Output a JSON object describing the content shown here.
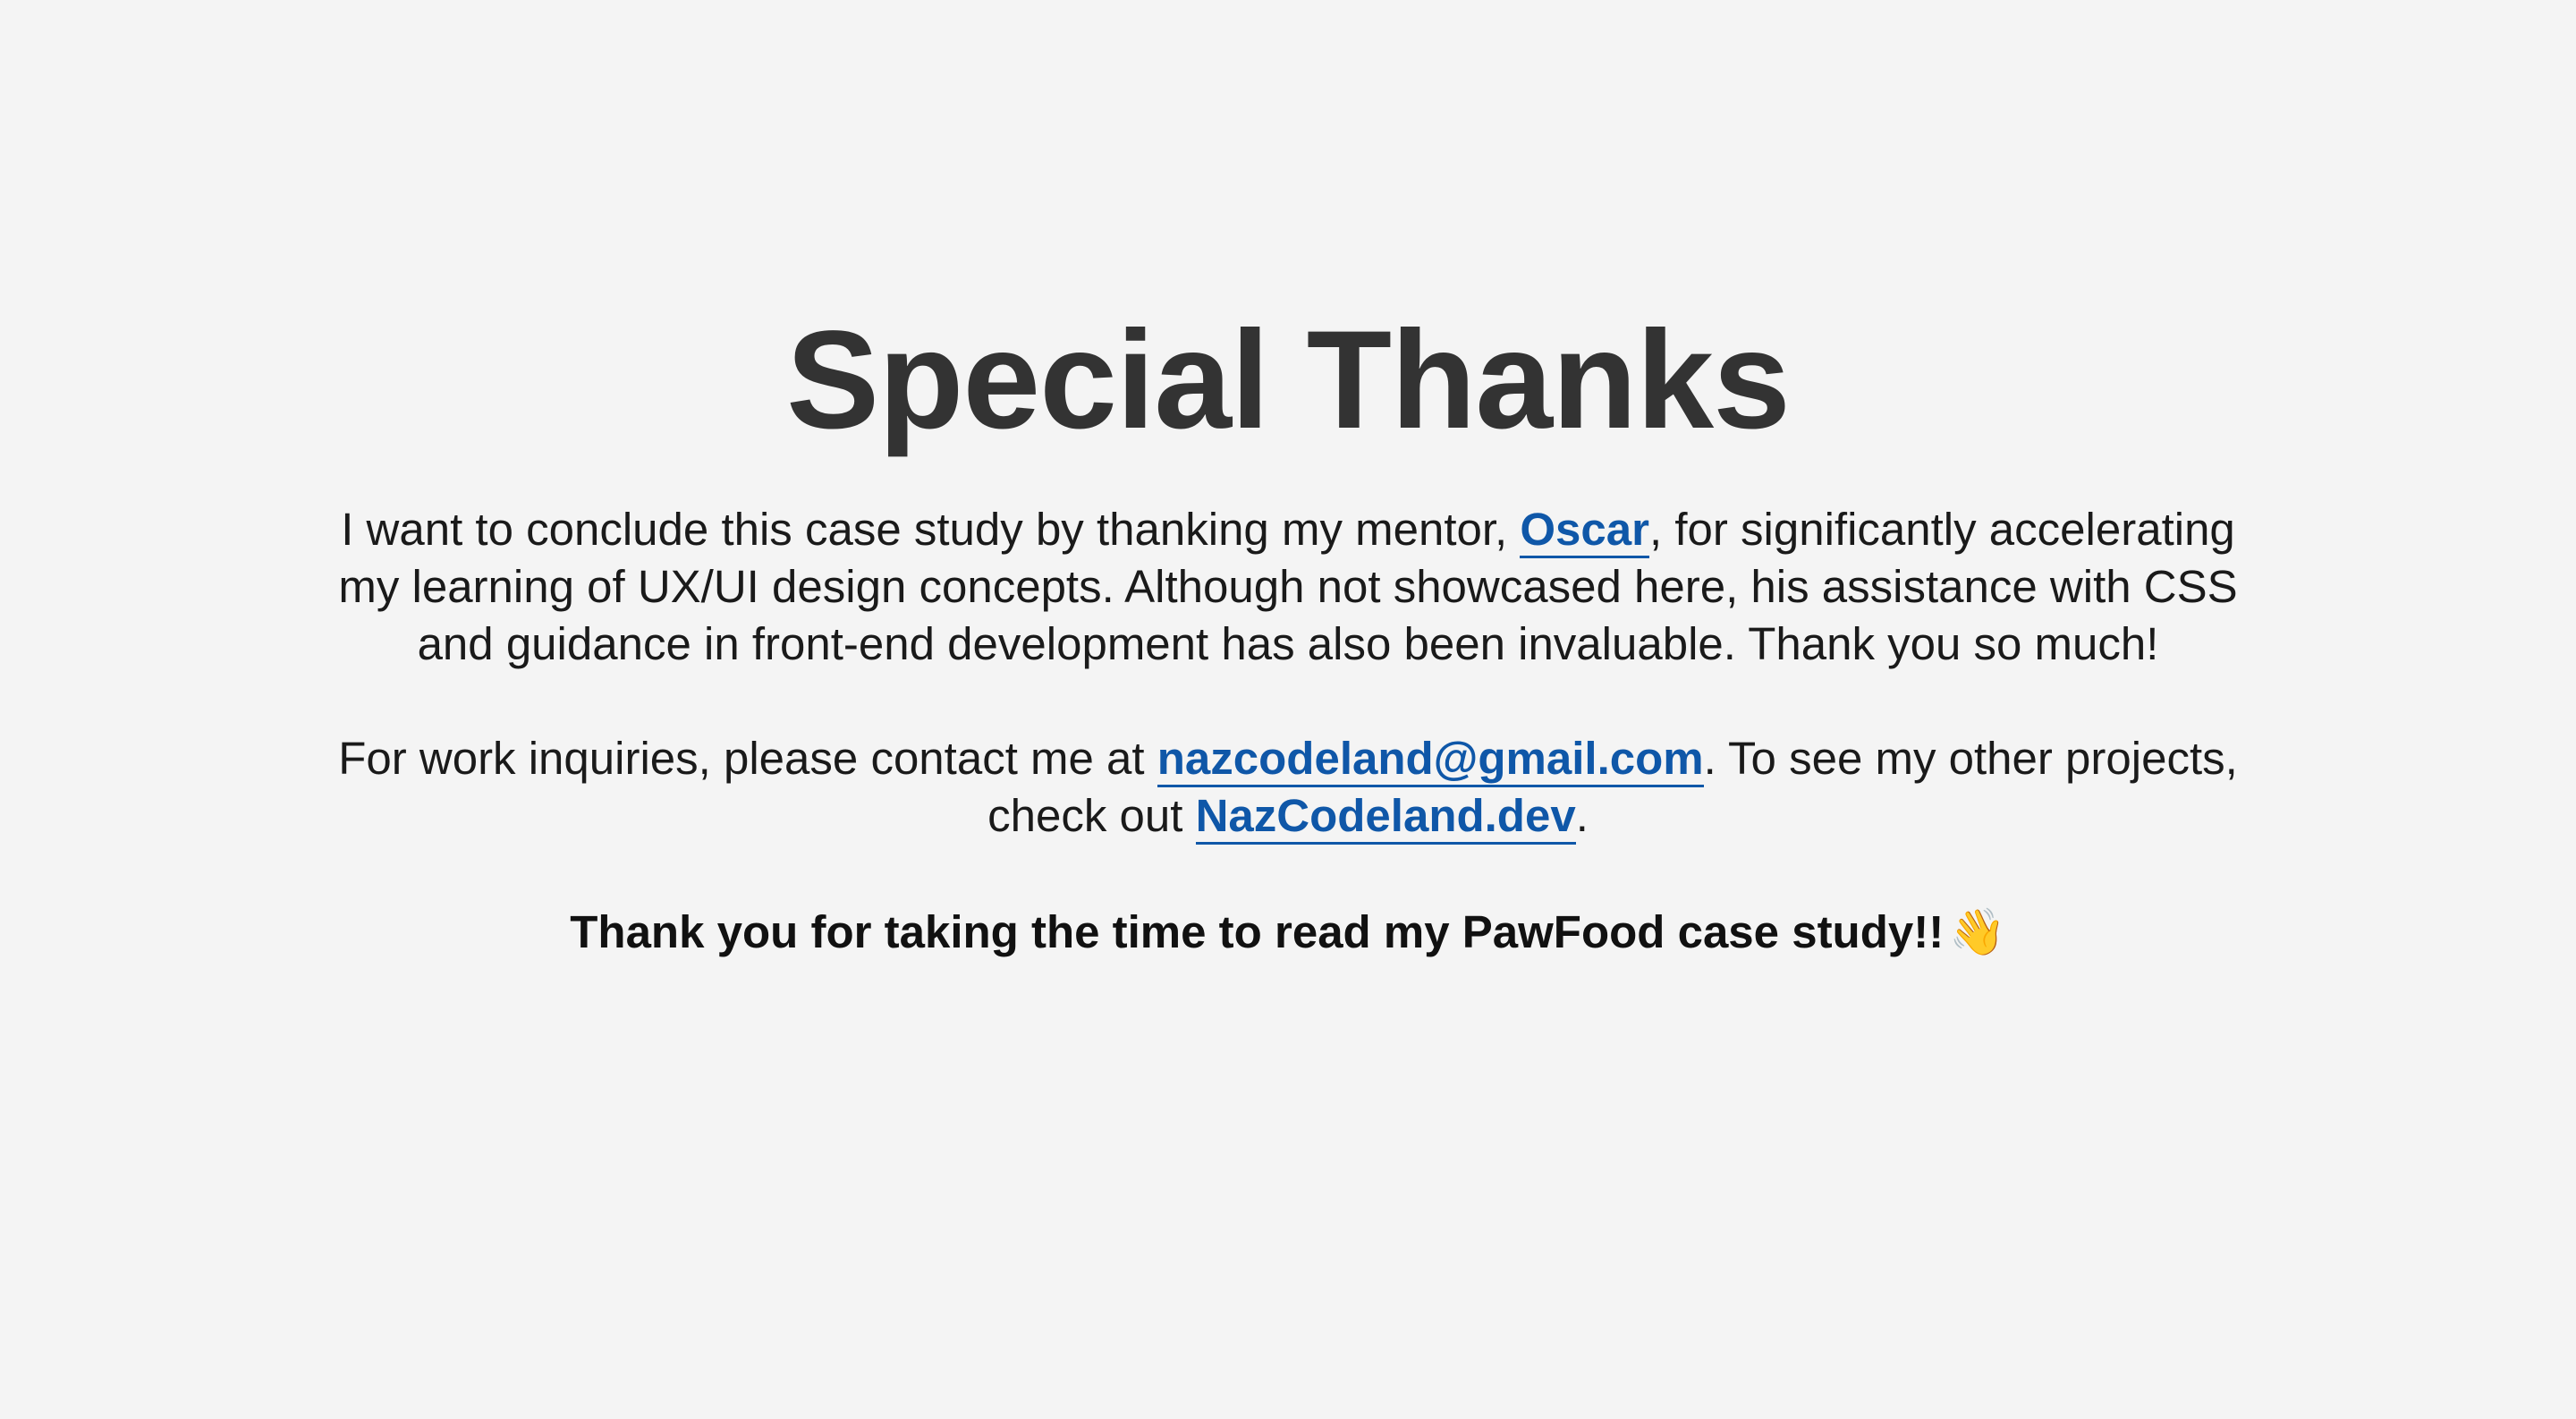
{
  "heading": {
    "title": "Special Thanks"
  },
  "mentor_paragraph": {
    "text_before": "I want to conclude this case study by thanking my mentor, ",
    "mentor_link": "Oscar",
    "text_after": ", for significantly accelerating my learning of UX/UI design concepts. Although not showcased here, his assistance with CSS and guidance in front-end development has also been invaluable. Thank you so much!"
  },
  "contact_paragraph": {
    "text_before": "For work inquiries, please contact me at ",
    "email_link": "nazcodeland@gmail.com",
    "text_middle": ". To see my other projects, check out ",
    "site_link": "NazCodeland.dev",
    "text_after": "."
  },
  "closing": {
    "text": "Thank you for taking the time to read my PawFood case study!!",
    "icon": "waving-hand-icon",
    "icon_glyph": "👋"
  },
  "colors": {
    "background": "#f4f4f4",
    "heading": "#333333",
    "body_text": "#1a1a1a",
    "link": "#0f57a8"
  }
}
